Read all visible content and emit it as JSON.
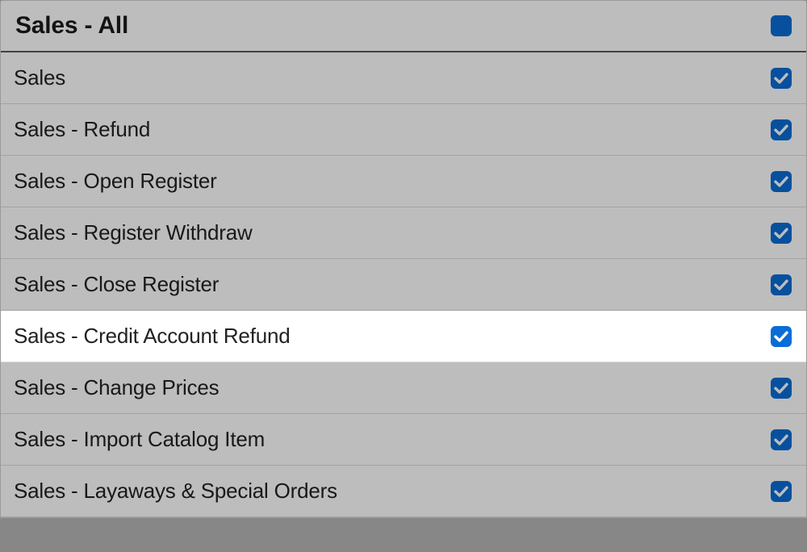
{
  "header": {
    "title": "Sales - All",
    "state": "indeterminate"
  },
  "items": [
    {
      "label": "Sales",
      "checked": true,
      "highlight": false
    },
    {
      "label": "Sales - Refund",
      "checked": true,
      "highlight": false
    },
    {
      "label": "Sales - Open Register",
      "checked": true,
      "highlight": false
    },
    {
      "label": "Sales - Register Withdraw",
      "checked": true,
      "highlight": false
    },
    {
      "label": "Sales - Close Register",
      "checked": true,
      "highlight": false
    },
    {
      "label": "Sales - Credit Account Refund",
      "checked": true,
      "highlight": true
    },
    {
      "label": "Sales - Change Prices",
      "checked": true,
      "highlight": false
    },
    {
      "label": "Sales - Import Catalog Item",
      "checked": true,
      "highlight": false
    },
    {
      "label": "Sales - Layaways & Special Orders",
      "checked": true,
      "highlight": false
    }
  ],
  "colors": {
    "accent": "#0a6dd6"
  }
}
